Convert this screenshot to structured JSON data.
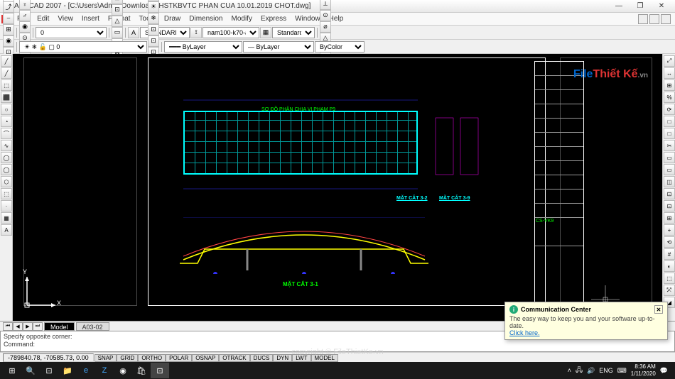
{
  "title": "AutoCAD 2007 - [C:\\Users\\Admin\\Downloads\\HSTKBVTC PHAN CUA 10.01.2019 CHOT.dwg]",
  "menu": [
    "File",
    "Edit",
    "View",
    "Insert",
    "Format",
    "Tools",
    "Draw",
    "Dimension",
    "Modify",
    "Express",
    "Window",
    "Help"
  ],
  "toolbar1": {
    "coord_input": "0"
  },
  "toolbar2": {
    "textstyle": "STANDARD",
    "dimstyle": "nam100-k70-a3",
    "tablestyle": "Standard",
    "layer": "0",
    "linetype": "ByLayer",
    "lineweight": "ByLayer",
    "color": "ByColor"
  },
  "left_tools": [
    "╱",
    "╱",
    "⬚",
    "⬛",
    "○",
    "◔",
    "⌒",
    "∿",
    "◯",
    "◯",
    "⬡",
    "⬚",
    "·",
    "▦",
    "A"
  ],
  "right_tools": [
    "⤢",
    "↔",
    "⊞",
    "%",
    "⟳",
    "□",
    "□",
    "✂",
    "▭",
    "▭",
    "◫",
    "⊡",
    "⊡",
    "⊞",
    "+",
    "⟲",
    "#",
    "◐",
    "⬚",
    "⤱",
    "◢"
  ],
  "drawing": {
    "top_label": "SƠ ĐỒ PHÂN CHIA VI PHẠM P9",
    "section_32": "MẶT CẮT 3-2",
    "section_39": "MẶT CẮT 3-9",
    "section_31": "MẶT CẮT 3-1",
    "block_id": "CS-VK9"
  },
  "tabs": {
    "model": "Model",
    "layout": "A03-02"
  },
  "cmd": {
    "l1": "Specify opposite corner:",
    "l2": "Command:"
  },
  "status": {
    "coords": "-789840.78, -70585.73, 0.00",
    "toggles": [
      "SNAP",
      "GRID",
      "ORTHO",
      "POLAR",
      "OSNAP",
      "OTRACK",
      "DUCS",
      "DYN",
      "LWT",
      "MODEL"
    ]
  },
  "popup": {
    "title": "Communication Center",
    "body": "The easy way to keep you and your software up-to-date.",
    "link": "Click here."
  },
  "tray": {
    "lang": "ENG",
    "time": "8:36 AM",
    "date": "1/11/2020"
  },
  "ucs": {
    "x": "X",
    "y": "Y"
  },
  "tb_glyphs1": [
    "▢",
    "▣",
    "⎙",
    "✂",
    "⎘",
    "⎘",
    "↶",
    "↷",
    "⤴",
    "⎯",
    "⊞",
    "◉",
    "⊡",
    "◫",
    "?",
    "⊞"
  ],
  "tb_glyphs2": [
    "♀",
    "♂",
    "◉",
    "⊙",
    "◐",
    "⊡"
  ],
  "tb_glyphs3": [
    "▤",
    "A",
    "▦",
    "✎",
    "⊞",
    "⊡",
    "△",
    "▭",
    "⊡",
    "⊠",
    "⊡",
    "⊡",
    "⟐",
    "⊡",
    "≡"
  ],
  "tb_glyphs4": [
    "↔",
    "↔",
    "↕",
    "↔",
    "⊥",
    "⊥",
    "⟂",
    "⊙",
    "⌀",
    "△",
    "⊡",
    "↔",
    "⊡",
    "≡",
    "⊡",
    "A",
    "⊡",
    "≡"
  ],
  "layer_tools": [
    "≡",
    "☀",
    "❄",
    "⊡",
    "⊡",
    "⊡",
    "⊡",
    "⊡",
    "⊡",
    "⊡"
  ]
}
